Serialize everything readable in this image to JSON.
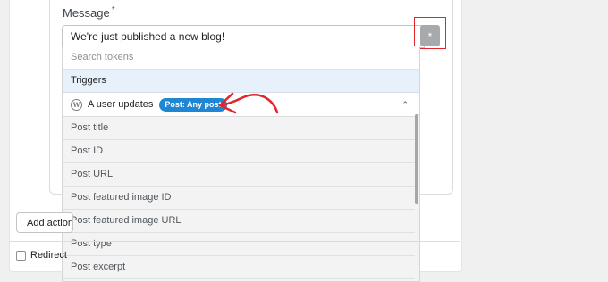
{
  "message_field": {
    "label": "Message",
    "required_mark": "*",
    "value": "We're just published a new blog!",
    "token_button_label": "*"
  },
  "token_dropdown": {
    "search_placeholder": "Search tokens",
    "section_label": "Triggers",
    "group": {
      "icon": "wordpress-icon",
      "label": "A user updates",
      "badge": "Post: Any post",
      "chevron": "chevron-up-icon"
    },
    "items": [
      "Post title",
      "Post ID",
      "Post URL",
      "Post featured image ID",
      "Post featured image URL",
      "Post type",
      "Post excerpt"
    ]
  },
  "footer": {
    "add_action_label": "Add action",
    "redirect_label": "Redirect"
  },
  "annotation": {
    "highlight_color": "#e2252b",
    "badge_color": "#1f86d4"
  }
}
